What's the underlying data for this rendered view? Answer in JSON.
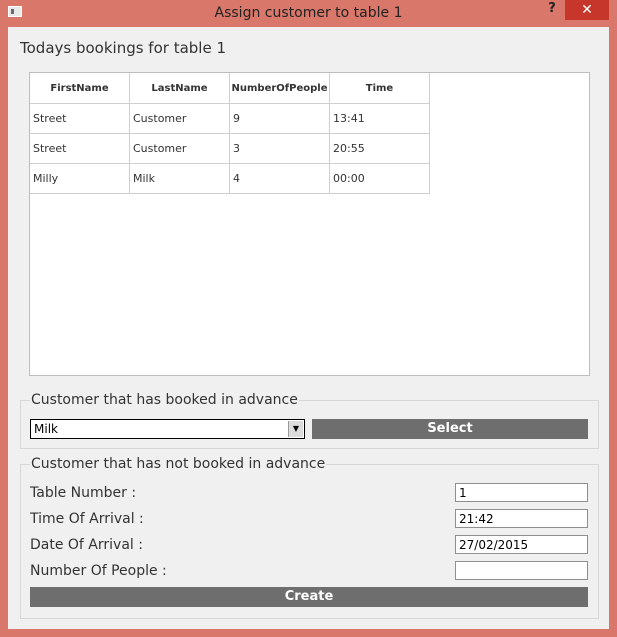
{
  "window": {
    "title": "Assign customer to table 1",
    "help": "?",
    "close": "✕"
  },
  "heading": "Todays bookings for table 1",
  "bookings": {
    "columns": [
      "FirstName",
      "LastName",
      "NumberOfPeople",
      "Time"
    ],
    "rows": [
      [
        "Street",
        "Customer",
        "9",
        "13:41"
      ],
      [
        "Street",
        "Customer",
        "3",
        "20:55"
      ],
      [
        "Milly",
        "Milk",
        "4",
        "00:00"
      ]
    ]
  },
  "advance": {
    "title": "Customer that has booked in advance",
    "selected": "Milk",
    "select_label": "Select"
  },
  "walkin": {
    "title": "Customer that has not booked in advance",
    "table_number_label": "Table Number :",
    "table_number": "1",
    "time_label": "Time Of Arrival :",
    "time": "21:42",
    "date_label": "Date Of Arrival :",
    "date": "27/02/2015",
    "people_label": "Number Of People :",
    "people": "",
    "create_label": "Create"
  },
  "colors": {
    "frame": "#d9776a",
    "close_bg": "#c7362a",
    "button_bg": "#6e6e6e"
  },
  "icons": {
    "app": "window-icon",
    "combo": "chevron-down-icon"
  }
}
